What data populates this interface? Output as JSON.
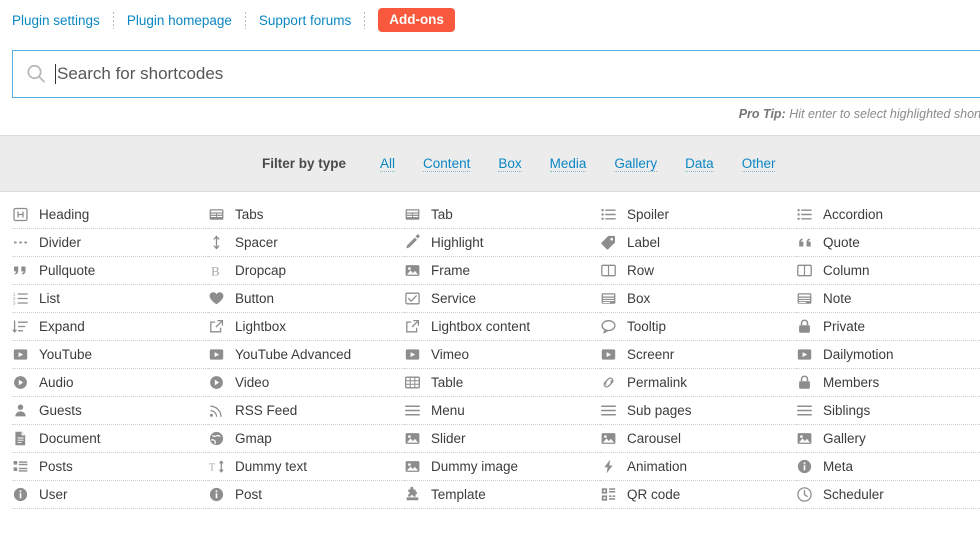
{
  "topnav": {
    "links": [
      {
        "label": "Plugin settings"
      },
      {
        "label": "Plugin homepage"
      },
      {
        "label": "Support forums"
      }
    ],
    "addons_label": "Add-ons",
    "addons_color": "#f8593c",
    "link_color": "#0b87c4"
  },
  "search": {
    "placeholder": "Search for shortcodes",
    "value": "",
    "icon": "search-icon",
    "border_color": "#53b0e0"
  },
  "protip": {
    "prefix": "Pro Tip:",
    "text": " Hit enter to select highlighted shortcode, while sear"
  },
  "filter": {
    "label": "Filter by type",
    "options": [
      {
        "label": "All"
      },
      {
        "label": "Content"
      },
      {
        "label": "Box"
      },
      {
        "label": "Media"
      },
      {
        "label": "Gallery"
      },
      {
        "label": "Data"
      },
      {
        "label": "Other"
      }
    ],
    "background": "#ececec"
  },
  "shortcodes": {
    "columns": [
      [
        {
          "label": "Heading",
          "icon": "heading-icon"
        },
        {
          "label": "Divider",
          "icon": "divider-icon"
        },
        {
          "label": "Pullquote",
          "icon": "quote-left-icon"
        },
        {
          "label": "List",
          "icon": "ordered-list-icon"
        },
        {
          "label": "Expand",
          "icon": "sort-amount-icon"
        },
        {
          "label": "YouTube",
          "icon": "play-square-icon"
        },
        {
          "label": "Audio",
          "icon": "play-circle-icon"
        },
        {
          "label": "Guests",
          "icon": "user-icon"
        },
        {
          "label": "Document",
          "icon": "document-icon"
        },
        {
          "label": "Posts",
          "icon": "list-grid-icon"
        },
        {
          "label": "User",
          "icon": "info-circle-icon"
        }
      ],
      [
        {
          "label": "Tabs",
          "icon": "tabs-icon"
        },
        {
          "label": "Spacer",
          "icon": "arrows-v-icon"
        },
        {
          "label": "Dropcap",
          "icon": "bold-b-icon"
        },
        {
          "label": "Button",
          "icon": "heart-icon"
        },
        {
          "label": "Lightbox",
          "icon": "external-link-icon"
        },
        {
          "label": "YouTube Advanced",
          "icon": "play-square-icon"
        },
        {
          "label": "Video",
          "icon": "play-circle-icon"
        },
        {
          "label": "RSS Feed",
          "icon": "rss-icon"
        },
        {
          "label": "Gmap",
          "icon": "globe-icon"
        },
        {
          "label": "Dummy text",
          "icon": "text-height-icon"
        },
        {
          "label": "Post",
          "icon": "info-circle-icon"
        }
      ],
      [
        {
          "label": "Tab",
          "icon": "tabs-icon"
        },
        {
          "label": "Highlight",
          "icon": "pencil-icon"
        },
        {
          "label": "Frame",
          "icon": "image-icon"
        },
        {
          "label": "Service",
          "icon": "check-square-icon"
        },
        {
          "label": "Lightbox content",
          "icon": "external-link-icon"
        },
        {
          "label": "Vimeo",
          "icon": "play-square-icon"
        },
        {
          "label": "Table",
          "icon": "table-icon"
        },
        {
          "label": "Menu",
          "icon": "bars-icon"
        },
        {
          "label": "Slider",
          "icon": "image-icon"
        },
        {
          "label": "Dummy image",
          "icon": "image-icon"
        },
        {
          "label": "Template",
          "icon": "puzzle-icon"
        }
      ],
      [
        {
          "label": "Spoiler",
          "icon": "list-ul-icon"
        },
        {
          "label": "Label",
          "icon": "tag-icon"
        },
        {
          "label": "Row",
          "icon": "columns-icon"
        },
        {
          "label": "Box",
          "icon": "box-icon"
        },
        {
          "label": "Tooltip",
          "icon": "comment-icon"
        },
        {
          "label": "Screenr",
          "icon": "play-square-icon"
        },
        {
          "label": "Permalink",
          "icon": "chain-icon"
        },
        {
          "label": "Sub pages",
          "icon": "bars-icon"
        },
        {
          "label": "Carousel",
          "icon": "image-icon"
        },
        {
          "label": "Animation",
          "icon": "bolt-icon"
        },
        {
          "label": "QR code",
          "icon": "qrcode-icon"
        }
      ],
      [
        {
          "label": "Accordion",
          "icon": "list-ul-icon"
        },
        {
          "label": "Quote",
          "icon": "quote-right-icon"
        },
        {
          "label": "Column",
          "icon": "columns-icon"
        },
        {
          "label": "Note",
          "icon": "box-icon"
        },
        {
          "label": "Private",
          "icon": "lock-icon"
        },
        {
          "label": "Dailymotion",
          "icon": "play-square-icon"
        },
        {
          "label": "Members",
          "icon": "lock-icon"
        },
        {
          "label": "Siblings",
          "icon": "bars-icon"
        },
        {
          "label": "Gallery",
          "icon": "image-icon"
        },
        {
          "label": "Meta",
          "icon": "info-circle-icon"
        },
        {
          "label": "Scheduler",
          "icon": "clock-icon"
        }
      ]
    ]
  }
}
